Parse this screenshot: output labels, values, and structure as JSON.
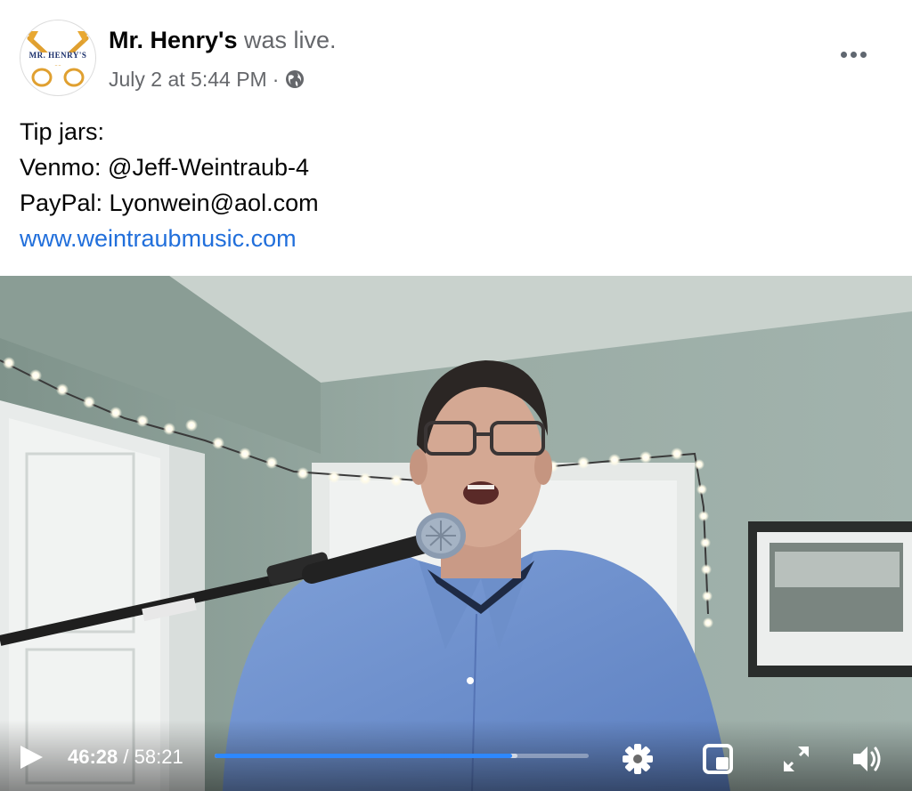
{
  "post": {
    "page_name": "Mr. Henry's",
    "status_text": "was live.",
    "date": "July 2 at 5:44 PM",
    "separator": "·",
    "privacy_icon": "globe-icon",
    "avatar_text": "MR. HENRY'S",
    "more_icon": "more-options-icon"
  },
  "body": {
    "lines": [
      "Tip jars:",
      "Venmo: @Jeff-Weintraub-4",
      "PayPal: Lyonwein@aol.com"
    ],
    "link": "www.weintraubmusic.com"
  },
  "video": {
    "current_time": "46:28",
    "time_separator": "/",
    "duration": "58:21",
    "progress_fraction": 0.796,
    "buffered_fraction": 0.81,
    "accent_color": "#2d88ff",
    "icons": [
      "play-icon",
      "settings-gear-icon",
      "picture-in-picture-icon",
      "fullscreen-expand-icon",
      "volume-icon"
    ]
  }
}
